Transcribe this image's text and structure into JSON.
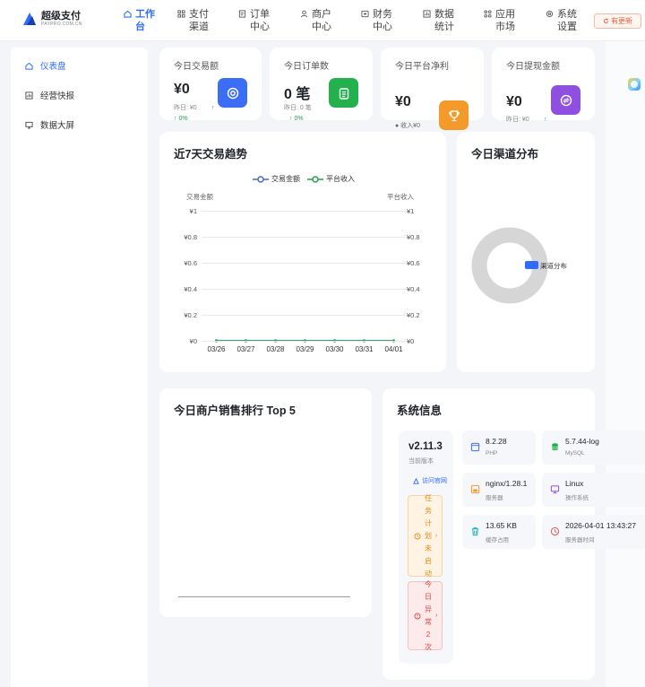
{
  "brand": {
    "name": "超级支付",
    "subtitle": "PAYPRO.COM.CN"
  },
  "nav": [
    {
      "label": "工作台",
      "icon": "home-icon",
      "active": true
    },
    {
      "label": "支付渠道",
      "icon": "grid-icon"
    },
    {
      "label": "订单中心",
      "icon": "list-icon"
    },
    {
      "label": "商户中心",
      "icon": "user-icon"
    },
    {
      "label": "财务中心",
      "icon": "wallet-icon"
    },
    {
      "label": "数据统计",
      "icon": "chart-icon"
    },
    {
      "label": "应用市场",
      "icon": "apps-icon"
    },
    {
      "label": "系统设置",
      "icon": "settings-icon"
    }
  ],
  "update_label": "有更新",
  "sidebar": {
    "items": [
      {
        "label": "仪表盘",
        "icon": "dashboard-icon",
        "active": true
      },
      {
        "label": "经营快报",
        "icon": "report-icon"
      },
      {
        "label": "数据大屏",
        "icon": "screen-icon"
      }
    ]
  },
  "stats": [
    {
      "title": "今日交易额",
      "value": "¥0",
      "sub": "昨日: ¥0",
      "pct": "↑ 0%",
      "icon": "target-icon",
      "color": "#3b6ef5"
    },
    {
      "title": "今日订单数",
      "value": "0 笔",
      "sub": "昨日: 0 笔",
      "pct": "↑ 0%",
      "icon": "clipboard-icon",
      "color": "#22b14c"
    },
    {
      "title": "今日平台净利",
      "value": "¥0",
      "sub": "● 收入¥0",
      "pct": "",
      "icon": "trophy-icon",
      "color": "#f49a2a"
    },
    {
      "title": "今日提现金额",
      "value": "¥0",
      "sub": "昨日: ¥0",
      "pct": "↑",
      "icon": "exchange-icon",
      "color": "#8f4fe0"
    }
  ],
  "trend": {
    "title": "近7天交易趋势",
    "legend": [
      "交易金额",
      "平台收入"
    ],
    "left_axis_title": "交易金额",
    "right_axis_title": "平台收入",
    "yticks": [
      "¥1",
      "¥0.8",
      "¥0.6",
      "¥0.4",
      "¥0.2",
      "¥0"
    ]
  },
  "chart_data": [
    {
      "type": "line",
      "title": "近7天交易趋势",
      "categories": [
        "03/26",
        "03/27",
        "03/28",
        "03/29",
        "03/30",
        "03/31",
        "04/01"
      ],
      "series": [
        {
          "name": "交易金额",
          "values": [
            0,
            0,
            0,
            0,
            0,
            0,
            0
          ],
          "color": "#4a6bc2"
        },
        {
          "name": "平台收入",
          "values": [
            0,
            0,
            0,
            0,
            0,
            0,
            0
          ],
          "color": "#2aa14a"
        }
      ],
      "ylabel_left": "交易金额",
      "ylabel_right": "平台收入",
      "ylim": [
        0,
        1
      ],
      "grid": true,
      "legend_position": "top"
    },
    {
      "type": "pie",
      "title": "今日渠道分布",
      "categories": [
        "渠道分布"
      ],
      "values": [
        0
      ],
      "legend_position": "right"
    }
  ],
  "channel": {
    "title": "今日渠道分布",
    "legend": "渠道分布"
  },
  "ranking": {
    "title": "今日商户销售排行 Top 5"
  },
  "sysinfo": {
    "title": "系统信息",
    "version": "v2.11.3",
    "version_label": "当前版本",
    "site_link": "访问官网",
    "task_status": "任务计划未启动",
    "task_error": "今日异常2次",
    "tiles": [
      {
        "value": "8.2.28",
        "label": "PHP",
        "icon": "code-icon",
        "color": "#3b6ef5"
      },
      {
        "value": "5.7.44-log",
        "label": "MySQL",
        "icon": "database-icon",
        "color": "#22b14c"
      },
      {
        "value": "nginx/1.28.1",
        "label": "服务器",
        "icon": "server-icon",
        "color": "#f49a2a"
      },
      {
        "value": "Linux",
        "label": "操作系统",
        "icon": "monitor-icon",
        "color": "#8f4fe0"
      },
      {
        "value": "13.65 KB",
        "label": "缓存占用",
        "icon": "trash-icon",
        "color": "#19b5b0"
      },
      {
        "value": "2026-04-01 13:43:27",
        "label": "服务器时间",
        "icon": "clock-icon",
        "color": "#e25a5a"
      }
    ]
  }
}
